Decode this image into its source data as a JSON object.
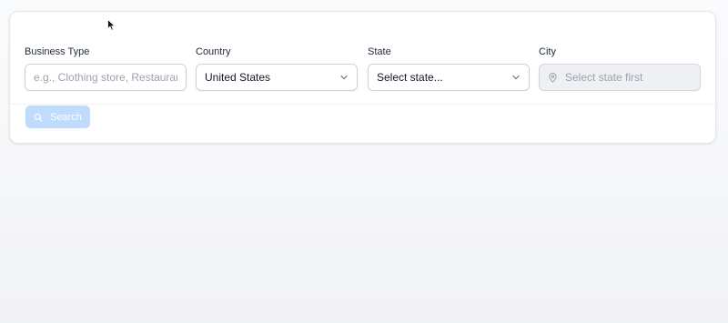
{
  "filters": {
    "business_type": {
      "label": "Business Type",
      "placeholder": "e.g., Clothing store, Restaurant, Plumber"
    },
    "country": {
      "label": "Country",
      "value": "United States"
    },
    "state": {
      "label": "State",
      "value": "Select state..."
    },
    "city": {
      "label": "City",
      "value": "Select state first",
      "disabled": true
    }
  },
  "search_button": {
    "label": "Search",
    "enabled": false
  },
  "icons": {
    "chevron": "chevron-down-icon",
    "pin": "map-pin-icon",
    "search": "search-icon"
  },
  "colors": {
    "button_disabled": "#bfdbfe",
    "border": "#cdd1d7"
  }
}
